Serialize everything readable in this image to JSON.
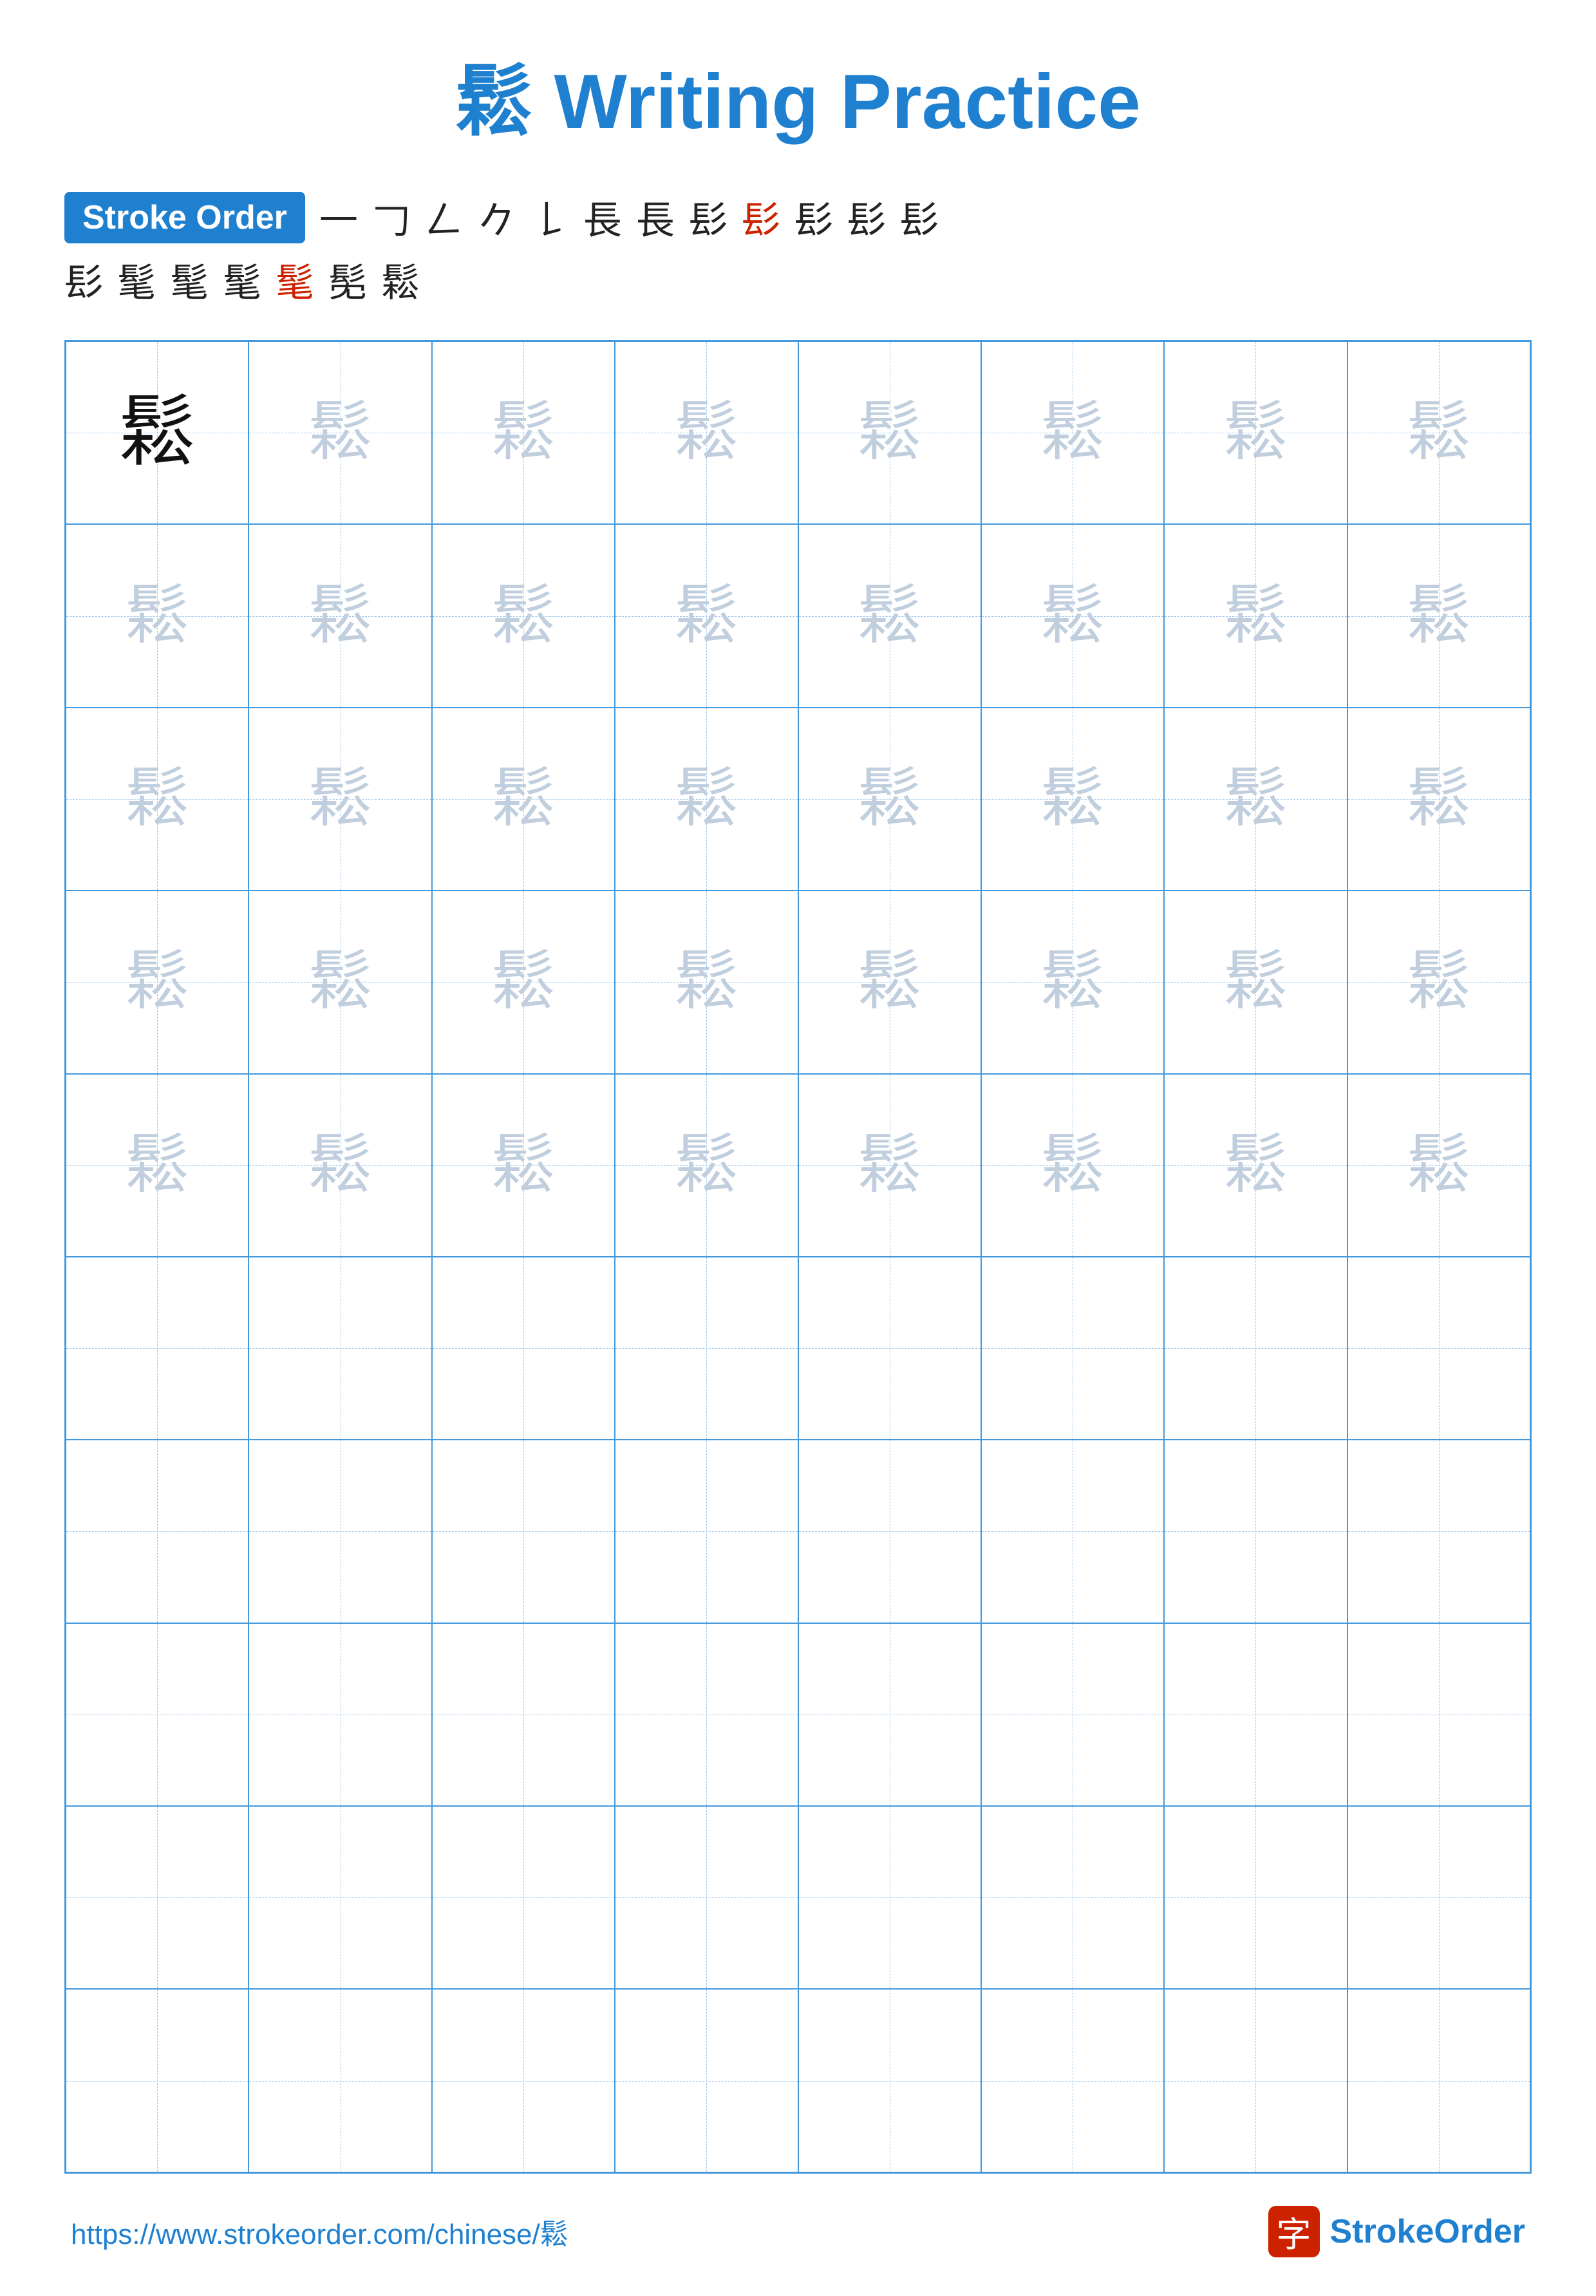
{
  "title": {
    "char": "鬆",
    "label": "Writing Practice",
    "full": "鬆 Writing Practice"
  },
  "stroke_order": {
    "badge_label": "Stroke Order",
    "strokes_row1": [
      "一",
      "𠃌",
      "𠃋",
      "𠂊",
      "𠄌",
      "長",
      "長",
      "髟",
      "髟",
      "髟",
      "髟",
      "髟"
    ],
    "strokes_row2": [
      "髟",
      "髦",
      "髦",
      "髦",
      "髦",
      "髧",
      "鬆"
    ],
    "last_red_index": 6
  },
  "grid": {
    "cols": 8,
    "rows": 10,
    "model_char": "鬆",
    "practice_char": "鬆",
    "filled_rows": 5
  },
  "footer": {
    "url": "https://www.strokeorder.com/chinese/鬆",
    "logo_char": "字",
    "logo_text_stroke": "Stroke",
    "logo_text_order": "Order"
  }
}
